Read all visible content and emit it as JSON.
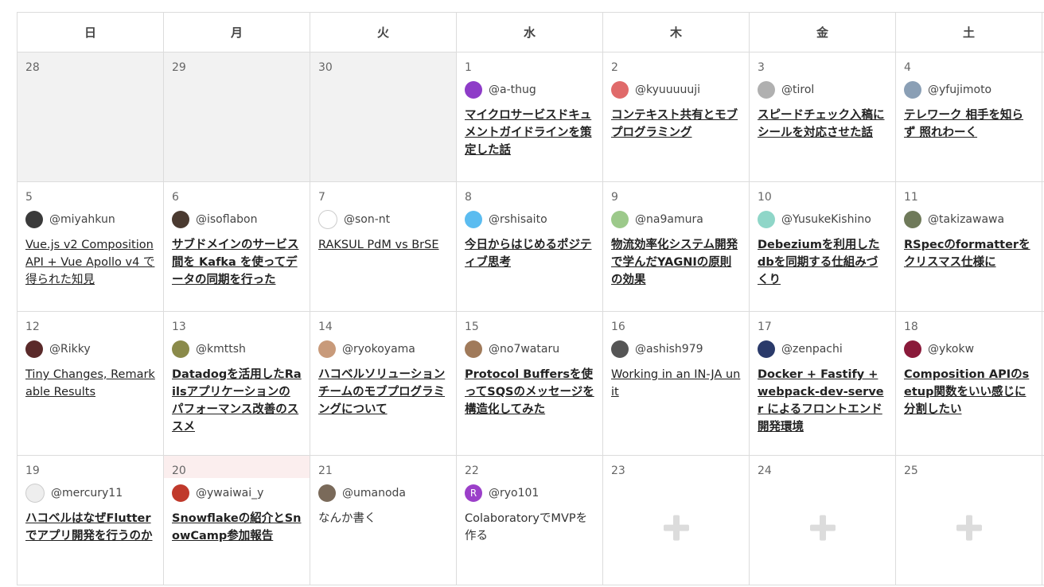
{
  "weekdays": [
    "日",
    "月",
    "火",
    "水",
    "木",
    "金",
    "土"
  ],
  "weeks": [
    [
      {
        "date": "28",
        "prev": true
      },
      {
        "date": "29",
        "prev": true
      },
      {
        "date": "30",
        "prev": true
      },
      {
        "date": "1",
        "author": "@a-thug",
        "avatar": "#8e3cc8",
        "title": "マイクロサービスドキュメントガイドラインを策定した話"
      },
      {
        "date": "2",
        "author": "@kyuuuuuji",
        "avatar": "#e06a6a",
        "title": "コンテキスト共有とモブプログラミング"
      },
      {
        "date": "3",
        "author": "@tirol",
        "avatar": "#b0b0b0",
        "title": "スピードチェック入稿にシールを対応させた話"
      },
      {
        "date": "4",
        "author": "@yfujimoto",
        "avatar": "#8a9fb5",
        "title": "テレワーク 相手を知らず 照れわーく"
      }
    ],
    [
      {
        "date": "5",
        "author": "@miyahkun",
        "avatar": "#3a3a3a",
        "title": "Vue.js v2 Composition API + Vue Apollo v4 で得られた知見",
        "plain": true
      },
      {
        "date": "6",
        "author": "@isoflabon",
        "avatar": "#4a3a30",
        "title": "サブドメインのサービス間を Kafka を使ってデータの同期を行った"
      },
      {
        "date": "7",
        "author": "@son-nt",
        "avatar": "#ffffff",
        "title": "RAKSUL PdM vs BrSE",
        "plain": true
      },
      {
        "date": "8",
        "author": "@rshisaito",
        "avatar": "#5bbcf0",
        "title": "今日からはじめるポジティブ思考"
      },
      {
        "date": "9",
        "author": "@na9amura",
        "avatar": "#9cc98a",
        "title": "物流効率化システム開発で学んだYAGNIの原則の効果"
      },
      {
        "date": "10",
        "author": "@YusukeKishino",
        "avatar": "#8fd6c8",
        "title": "Debeziumを利用したdbを同期する仕組みづくり"
      },
      {
        "date": "11",
        "author": "@takizawawa",
        "avatar": "#6f7a5a",
        "title": "RSpecのformatterをクリスマス仕様に"
      }
    ],
    [
      {
        "date": "12",
        "author": "@Rikky",
        "avatar": "#5a2a2a",
        "title": "Tiny Changes, Remarkable Results",
        "plain": true
      },
      {
        "date": "13",
        "author": "@kmttsh",
        "avatar": "#8a8a4a",
        "title": "Datadogを活用したRailsアプリケーションのパフォーマンス改善のススメ"
      },
      {
        "date": "14",
        "author": "@ryokoyama",
        "avatar": "#c89a7a",
        "title": "ハコベルソリューションチームのモブプログラミングについて"
      },
      {
        "date": "15",
        "author": "@no7wataru",
        "avatar": "#a07a5a",
        "title": "Protocol Buffersを使ってSQSのメッセージを構造化してみた"
      },
      {
        "date": "16",
        "author": "@ashish979",
        "avatar": "#555555",
        "title": "Working in an IN-JA unit",
        "plain": true
      },
      {
        "date": "17",
        "author": "@zenpachi",
        "avatar": "#2a3a6a",
        "title": "Docker + Fastify + webpack-dev-server によるフロントエンド開発環境"
      },
      {
        "date": "18",
        "author": "@ykokw",
        "avatar": "#8a1a3a",
        "title": "Composition APIのsetup関数をいい感じに分割したい"
      }
    ],
    [
      {
        "date": "19",
        "author": "@mercury11",
        "avatar": "#eeeeee",
        "title": "ハコベルはなぜFlutterでアプリ開発を行うのか"
      },
      {
        "date": "20",
        "today": true,
        "author": "@ywaiwai_y",
        "avatar": "#c0392b",
        "title": "Snowflakeの紹介とSnowCamp参加報告"
      },
      {
        "date": "21",
        "author": "@umanoda",
        "avatar": "#7a6a5a",
        "title": "なんか書く",
        "nolink": true
      },
      {
        "date": "22",
        "author": "@ryo101",
        "avatar": "#9b3fc9",
        "initial": "R",
        "title": "ColaboratoryでMVPを作る",
        "nolink": true
      },
      {
        "date": "23",
        "empty": true
      },
      {
        "date": "24",
        "empty": true
      },
      {
        "date": "25",
        "empty": true
      }
    ]
  ]
}
